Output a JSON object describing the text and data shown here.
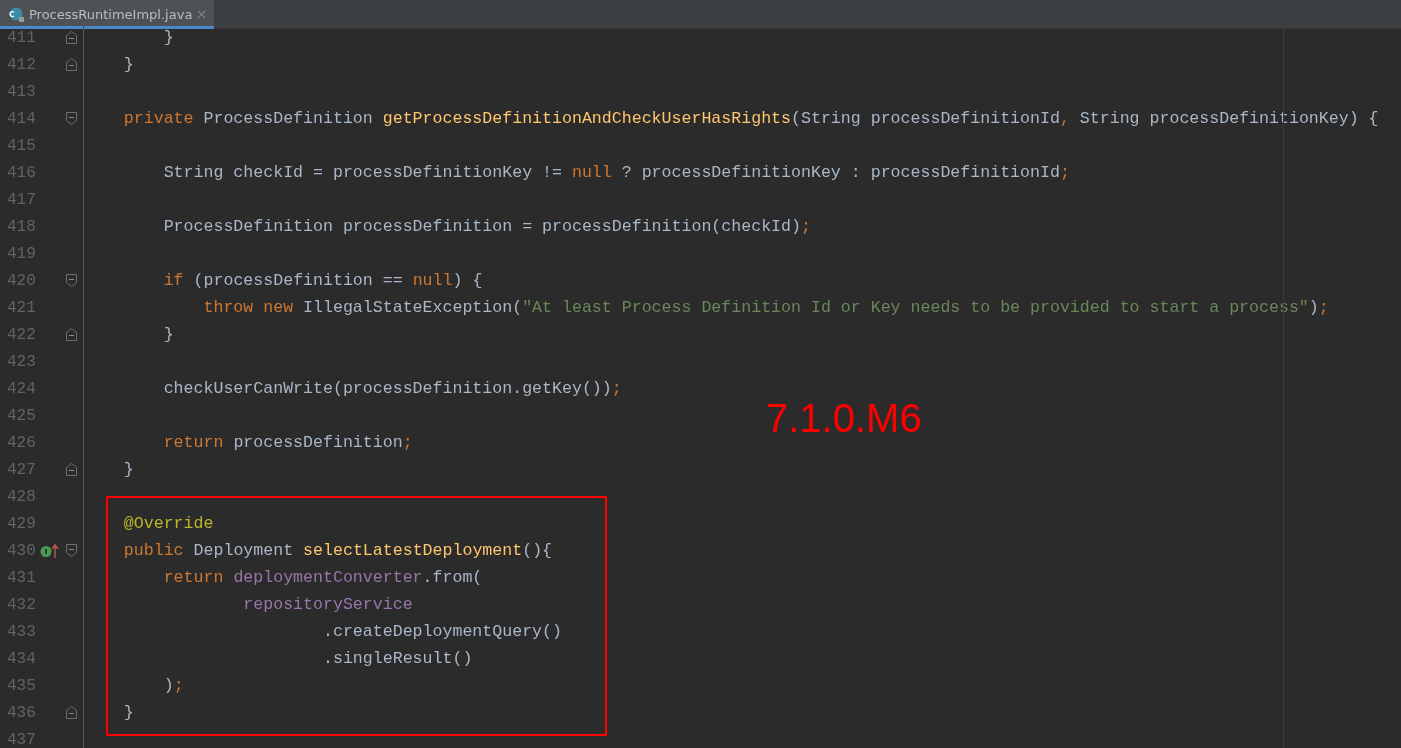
{
  "tabs": [
    {
      "label": "ProcessRuntimeImpl.java",
      "selected": true
    }
  ],
  "lines": [
    {
      "number": "411",
      "kind": "closer",
      "tokens": [
        {
          "kind": "plain",
          "text": "        }"
        }
      ]
    },
    {
      "number": "412",
      "kind": "closer",
      "tokens": [
        {
          "kind": "plain",
          "text": "    }"
        }
      ]
    },
    {
      "number": "413",
      "kind": "blank"
    },
    {
      "number": "414",
      "kind": "opener",
      "tokens": [
        {
          "kind": "keyword",
          "text": "    private "
        },
        {
          "kind": "plain",
          "text": "ProcessDefinition "
        },
        {
          "kind": "method",
          "text": "getProcessDefinitionAndCheckUserHasRights"
        },
        {
          "kind": "plain",
          "text": "(String processDefinitionId"
        },
        {
          "kind": "keyword",
          "text": ", "
        },
        {
          "kind": "plain",
          "text": "String processDefinitionKey) {"
        }
      ]
    },
    {
      "number": "415",
      "kind": "blank"
    },
    {
      "number": "416",
      "kind": "plain",
      "tokens": [
        {
          "kind": "plain",
          "text": "        String checkId = processDefinitionKey != "
        },
        {
          "kind": "keyword",
          "text": "null"
        },
        {
          "kind": "plain",
          "text": " ? processDefinitionKey : processDefinitionId"
        },
        {
          "kind": "keyword",
          "text": ";"
        }
      ]
    },
    {
      "number": "417",
      "kind": "blank"
    },
    {
      "number": "418",
      "kind": "plain",
      "tokens": [
        {
          "kind": "plain",
          "text": "        ProcessDefinition processDefinition = processDefinition(checkId)"
        },
        {
          "kind": "keyword",
          "text": ";"
        }
      ]
    },
    {
      "number": "419",
      "kind": "blank"
    },
    {
      "number": "420",
      "kind": "opener",
      "tokens": [
        {
          "kind": "keyword",
          "text": "        if "
        },
        {
          "kind": "plain",
          "text": "(processDefinition == "
        },
        {
          "kind": "keyword",
          "text": "null"
        },
        {
          "kind": "plain",
          "text": ") {"
        }
      ]
    },
    {
      "number": "421",
      "kind": "plain",
      "tokens": [
        {
          "kind": "keyword",
          "text": "            throw new "
        },
        {
          "kind": "plain",
          "text": "IllegalStateException("
        },
        {
          "kind": "string",
          "text": "\"At least Process Definition Id or Key needs to be provided to start a process\""
        },
        {
          "kind": "plain",
          "text": ")"
        },
        {
          "kind": "keyword",
          "text": ";"
        }
      ]
    },
    {
      "number": "422",
      "kind": "closer",
      "tokens": [
        {
          "kind": "plain",
          "text": "        }"
        }
      ]
    },
    {
      "number": "423",
      "kind": "blank"
    },
    {
      "number": "424",
      "kind": "plain",
      "tokens": [
        {
          "kind": "plain",
          "text": "        checkUserCanWrite(processDefinition.getKey())"
        },
        {
          "kind": "keyword",
          "text": ";"
        }
      ]
    },
    {
      "number": "425",
      "kind": "blank"
    },
    {
      "number": "426",
      "kind": "plain",
      "tokens": [
        {
          "kind": "keyword",
          "text": "        return "
        },
        {
          "kind": "plain",
          "text": "processDefinition"
        },
        {
          "kind": "keyword",
          "text": ";"
        }
      ]
    },
    {
      "number": "427",
      "kind": "closer",
      "tokens": [
        {
          "kind": "plain",
          "text": "    }"
        }
      ]
    },
    {
      "number": "428",
      "kind": "blank"
    },
    {
      "number": "429",
      "kind": "plain",
      "tokens": [
        {
          "kind": "annotation",
          "text": "    @Override"
        }
      ]
    },
    {
      "number": "430",
      "kind": "override",
      "tokens": [
        {
          "kind": "keyword",
          "text": "    public "
        },
        {
          "kind": "plain",
          "text": "Deployment "
        },
        {
          "kind": "method",
          "text": "selectLatestDeployment"
        },
        {
          "kind": "plain",
          "text": "(){"
        }
      ]
    },
    {
      "number": "431",
      "kind": "plain",
      "tokens": [
        {
          "kind": "keyword",
          "text": "        return "
        },
        {
          "kind": "field",
          "text": "deploymentConverter"
        },
        {
          "kind": "plain",
          "text": ".from("
        }
      ]
    },
    {
      "number": "432",
      "kind": "plain",
      "tokens": [
        {
          "kind": "field",
          "text": "                repositoryService"
        }
      ]
    },
    {
      "number": "433",
      "kind": "plain",
      "tokens": [
        {
          "kind": "plain",
          "text": "                        .createDeploymentQuery()"
        }
      ]
    },
    {
      "number": "434",
      "kind": "plain",
      "tokens": [
        {
          "kind": "plain",
          "text": "                        .singleResult()"
        }
      ]
    },
    {
      "number": "435",
      "kind": "plain",
      "tokens": [
        {
          "kind": "plain",
          "text": "        )"
        },
        {
          "kind": "keyword",
          "text": ";"
        }
      ]
    },
    {
      "number": "436",
      "kind": "closer",
      "tokens": [
        {
          "kind": "plain",
          "text": "    }"
        }
      ]
    },
    {
      "number": "437",
      "kind": "blank"
    }
  ],
  "annotation": {
    "text": "7.1.0.M6"
  }
}
